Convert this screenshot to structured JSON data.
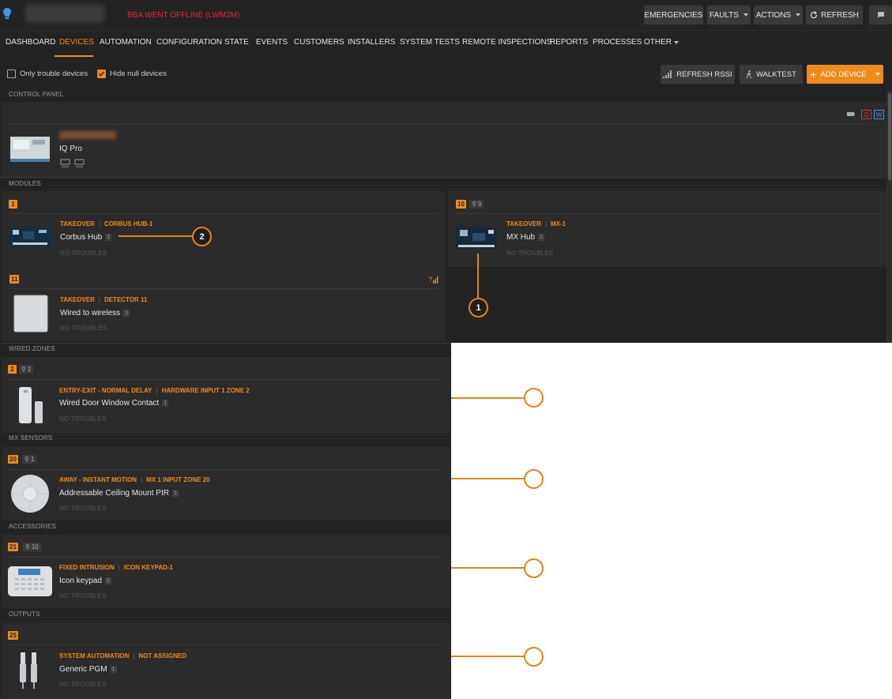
{
  "header": {
    "status_text": "BBA WENT OFFLINE (LWM2M)",
    "buttons": {
      "emergencies": "EMERGENCIES",
      "faults": "FAULTS",
      "actions": "ACTIONS",
      "refresh": "REFRESH"
    }
  },
  "nav": {
    "items": [
      "DASHBOARD",
      "DEVICES",
      "AUTOMATION",
      "CONFIGURATION",
      "STATE",
      "EVENTS",
      "CUSTOMERS",
      "INSTALLERS",
      "SYSTEM TESTS",
      "REMOTE INSPECTIONS",
      "REPORTS",
      "PROCESSES",
      "OTHER"
    ],
    "active": "DEVICES"
  },
  "filters": {
    "only_trouble": {
      "label": "Only trouble devices",
      "checked": false
    },
    "hide_null": {
      "label": "Hide null devices",
      "checked": true
    },
    "refresh_rssi": "REFRESH RSSI",
    "walktest": "WALKTEST",
    "add_device": "ADD DEVICE"
  },
  "control_panel": {
    "section_label": "CONTROL PANEL",
    "name": "IQ Pro",
    "flags": [
      "G",
      "W"
    ]
  },
  "modules": {
    "section_label": "MODULES",
    "items": [
      {
        "badge": "1",
        "category": "TAKEOVER",
        "location": "CORBUS HUB-1",
        "name": "Corbus Hub",
        "count": "1",
        "status": "NO TROUBLES"
      },
      {
        "badge": "10",
        "signal": "9",
        "category": "TAKEOVER",
        "location": "MX-1",
        "name": "MX Hub",
        "count": "1",
        "status": "NO TROUBLES"
      },
      {
        "badge": "11",
        "category": "TAKEOVER",
        "location": "DETECTOR 11",
        "name": "Wired to wireless",
        "count": "1",
        "status": "NO TROUBLES"
      }
    ]
  },
  "wired_zones": {
    "section_label": "WIRED ZONES",
    "badge": "2",
    "signal": "1",
    "category": "ENTRY-EXIT - NORMAL DELAY",
    "location": "HARDWARE INPUT 1 ZONE 2",
    "name": "Wired Door Window Contact",
    "count": "1",
    "status": "NO TROUBLES"
  },
  "mx_sensors": {
    "section_label": "MX SENSORS",
    "badge": "20",
    "signal": "1",
    "category": "AWAY - INSTANT MOTION",
    "location": "MX 1 INPUT ZONE 20",
    "name": "Addressable Ceiling Mount PIR",
    "count": "1",
    "status": "NO TROUBLES"
  },
  "accessories": {
    "section_label": "ACCESSORIES",
    "badge": "21",
    "signal": "10",
    "category": "FIXED INTRUSION",
    "location": "ICON KEYPAD-1",
    "name": "Icon keypad",
    "count": "1",
    "status": "NO TROUBLES"
  },
  "outputs": {
    "section_label": "OUTPUTS",
    "badge": "25",
    "category": "SYSTEM AUTOMATION",
    "location": "NOT ASSIGNED",
    "name": "Generic PGM",
    "count": "1",
    "status": "NO TROUBLES"
  },
  "callouts": {
    "one": "1",
    "two": "2"
  },
  "colors": {
    "accent": "#f08a1c",
    "alert": "#e8293b",
    "background": "#232323",
    "card": "#2b2b2b"
  }
}
